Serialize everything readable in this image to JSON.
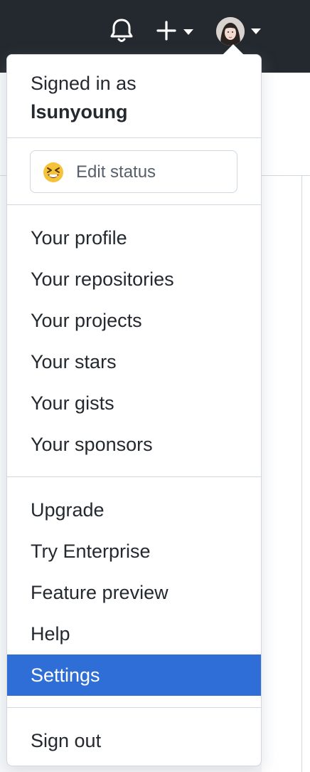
{
  "header": {
    "notifications_icon": "bell-icon",
    "create_icon": "plus-icon",
    "avatar_icon": "avatar",
    "bg_color": "#24292f"
  },
  "dropdown": {
    "signed_in_label": "Signed in as",
    "username": "lsunyoung",
    "status": {
      "emoji": "grinning-squinting-face",
      "label": "Edit status"
    },
    "group1": [
      {
        "label": "Your profile"
      },
      {
        "label": "Your repositories"
      },
      {
        "label": "Your projects"
      },
      {
        "label": "Your stars"
      },
      {
        "label": "Your gists"
      },
      {
        "label": "Your sponsors"
      }
    ],
    "group2": [
      {
        "label": "Upgrade"
      },
      {
        "label": "Try Enterprise"
      },
      {
        "label": "Feature preview"
      },
      {
        "label": "Help"
      },
      {
        "label": "Settings",
        "active": true
      }
    ],
    "sign_out": "Sign out",
    "active_color": "#2f6ed6"
  }
}
